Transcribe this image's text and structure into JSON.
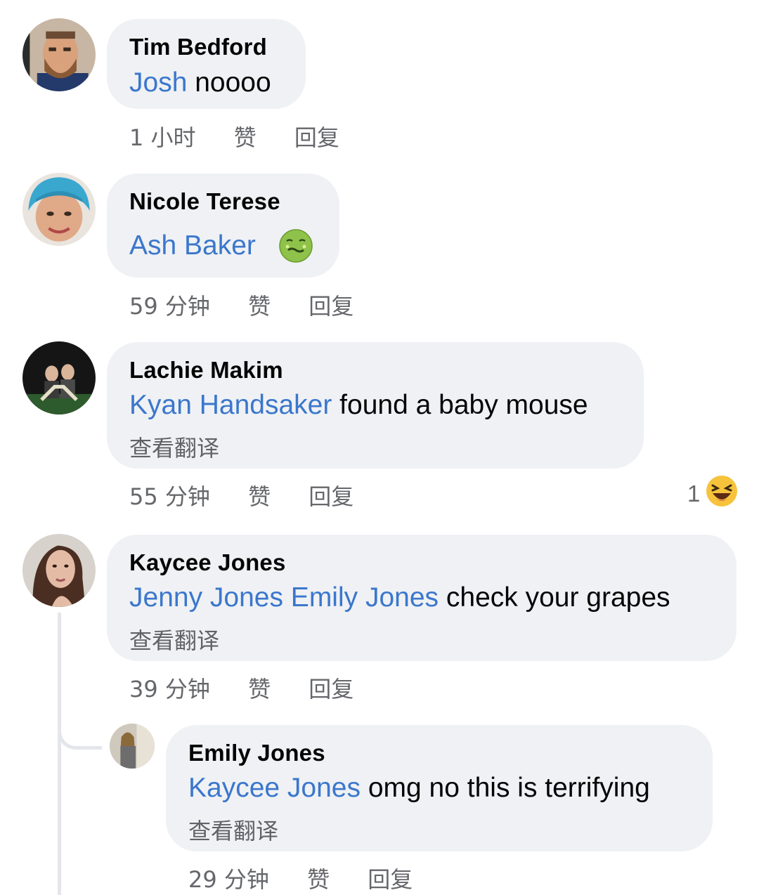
{
  "comments": [
    {
      "author": "Tim Bedford",
      "mention": "Josh",
      "text": " noooo",
      "time": "1 小时",
      "like": "赞",
      "reply": "回复"
    },
    {
      "author": "Nicole Terese",
      "mention": "Ash Baker",
      "emoji": "nauseated-face",
      "time": "59 分钟",
      "like": "赞",
      "reply": "回复"
    },
    {
      "author": "Lachie Makim",
      "mention": "Kyan Handsaker",
      "text": " found a baby mouse",
      "translate": "查看翻译",
      "time": "55 分钟",
      "like": "赞",
      "reply": "回复",
      "reaction_count": "1",
      "reaction": "laughing-emoji"
    },
    {
      "author": "Kaycee Jones",
      "mention": "Jenny Jones Emily Jones",
      "text": " check your grapes",
      "translate": "查看翻译",
      "time": "39 分钟",
      "like": "赞",
      "reply": "回复"
    },
    {
      "author": "Emily Jones",
      "mention": "Kaycee Jones",
      "text": " omg no this is terrifying",
      "translate": "查看翻译",
      "time": "29 分钟",
      "like": "赞",
      "reply": "回复"
    }
  ],
  "colors": {
    "mention": "#3b77cc",
    "bubble": "#eff1f4",
    "meta": "#65676b"
  }
}
